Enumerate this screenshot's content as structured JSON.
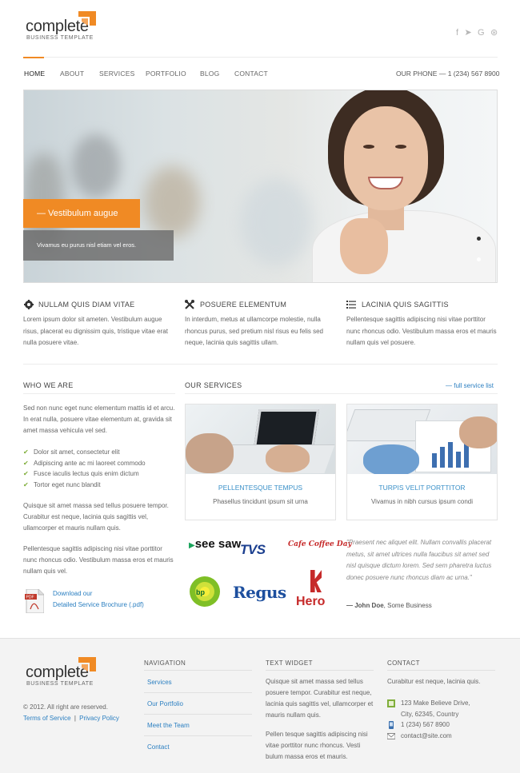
{
  "header": {
    "logo_word": "complete",
    "logo_sub": "BUSINESS TEMPLATE",
    "social": [
      "f",
      "twitter-bird",
      "G",
      "dribbble"
    ],
    "phone": "OUR PHONE — 1 (234) 567 8900"
  },
  "nav": [
    "HOME",
    "ABOUT",
    "SERVICES",
    "PORTFOLIO",
    "BLOG",
    "CONTACT"
  ],
  "hero": {
    "tag": "— Vestibulum augue",
    "caption": "Vivamus eu purus nisl etiam vel eros."
  },
  "features": [
    {
      "icon": "gear-icon",
      "title": "NULLAM QUIS DIAM VITAE",
      "text": "Lorem ipsum dolor sit ameten. Vestibulum augue risus, placerat eu dignissim quis, tristique vitae erat nulla posuere vitae."
    },
    {
      "icon": "tools-icon",
      "title": "POSUERE ELEMENTUM",
      "text": "In interdum, metus at ullamcorpe molestie, nulla rhoncus purus, sed pretium nisl risus eu felis sed neque, lacinia quis sagittis ullam."
    },
    {
      "icon": "list-icon",
      "title": "LACINIA QUIS SAGITTIS",
      "text": "Pellentesque sagittis adipiscing nisi vitae porttitor nunc rhoncus odio. Vestibulum massa eros et mauris nullam quis vel posuere."
    }
  ],
  "who": {
    "title": "WHO WE ARE",
    "intro": "Sed non nunc eget nunc elementum mattis id et arcu. In erat nulla, posuere vitae elementum at, gravida sit amet massa vehicula vel sed.",
    "checklist": [
      "Dolor sit amet, consectetur elit",
      "Adipiscing ante ac mi laoreet commodo",
      "Fusce iaculis lectus quis enim dictum",
      "Tortor eget nunc blandit"
    ],
    "para2": "Quisque sit amet massa sed tellus posuere tempor. Curabitur est neque, lacinia quis sagittis vel, ullamcorper et mauris nullam quis.",
    "para3": "Pellentesque sagittis adipiscing nisi vitae porttitor nunc rhoncus odio. Vestibulum massa eros et mauris nullam quis vel.",
    "download_line1": "Download our",
    "download_line2": "Detailed Service Brochure (.pdf)"
  },
  "services": {
    "title": "OUR SERVICES",
    "link": "— full service list",
    "cards": [
      {
        "title": "PELLENTESQUE TEMPUS",
        "sub": "Phasellus tincidunt ipsum sit urna"
      },
      {
        "title": "TURPIS VELIT PORTTITOR",
        "sub": "Vivamus in nibh cursus ipsum condi"
      }
    ]
  },
  "brands": [
    "see saw",
    "TVS",
    "Cafe Coffee Day",
    "bp",
    "Regus",
    "Hero"
  ],
  "quote": {
    "text": "\"Praesent nec aliquet elit. Nullam convallis placerat metus, sit amet ultrices nulla faucibus sit amet sed nisl quisque dictum lorem. Sed sem pharetra luctus donec posuere nunc rhoncus diam ac urna.\"",
    "author": "— John Doe",
    "company": ", Some Business"
  },
  "footer": {
    "copyright": "© 2012. All right are reserved.",
    "terms": "Terms of Service",
    "divider": "|",
    "privacy": "Privacy Policy",
    "nav_title": "NAVIGATION",
    "nav_items": [
      "Services",
      "Our Portfolio",
      "Meet the Team",
      "Contact"
    ],
    "widget_title": "TEXT WIDGET",
    "widget_p1": "Quisque sit amet massa sed tellus posuere tempor. Curabitur est neque, lacinia quis sagittis vel, ullamcorper et mauris nullam quis.",
    "widget_p2": "Pellen tesque sagittis adipiscing nisi vitae porttitor nunc rhoncus. Vesti bulum massa eros et mauris.",
    "contact_title": "CONTACT",
    "contact_intro": "Curabitur est neque, lacinia quis.",
    "address1": "123 Make Believe Drive,",
    "address2": "City, 62345, Country",
    "phone": "1 (234) 567 8900",
    "email": "contact@site.com"
  },
  "colors": {
    "accent": "#f08a24",
    "link": "#2b7fc1",
    "check": "#7fae3a"
  }
}
